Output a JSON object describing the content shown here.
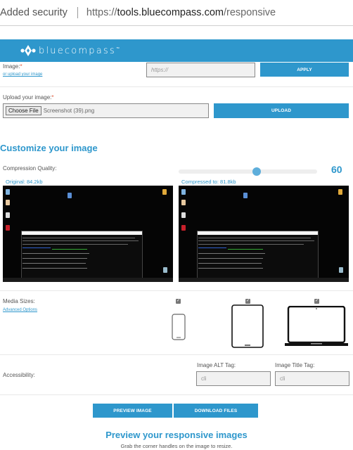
{
  "browser": {
    "security_label": "Added security",
    "url_prefix": "https://",
    "url_host": "tools.bluecompass.com",
    "url_path": "/responsive"
  },
  "brand": {
    "logo_text": "bluecompass",
    "trademark": "™",
    "bar_color": "#2e97cc"
  },
  "image_url_row": {
    "label": "Image:",
    "required_mark": "*",
    "upload_link": "or upload your image",
    "url_placeholder": "https://",
    "apply_label": "APPLY"
  },
  "upload_row": {
    "label": "Upload your image:",
    "required_mark": "*",
    "choose_file_label": "Choose File",
    "file_name": "Screenshot (39).png",
    "upload_label": "UPLOAD"
  },
  "customize": {
    "title": "Customize your image",
    "compression_label": "Compression Quality:",
    "compression_value": "60",
    "compression_fraction": 0.6,
    "original_label": "Original: 84.2kb",
    "compressed_label": "Compressed to: 81.8kb"
  },
  "media_sizes": {
    "label": "Media Sizes:",
    "advanced_link": "Advanced Options",
    "devices": [
      {
        "name": "phone",
        "checked": true,
        "check_glyph": "✓"
      },
      {
        "name": "tablet",
        "checked": true,
        "check_glyph": "✓"
      },
      {
        "name": "laptop",
        "checked": true,
        "check_glyph": "✓"
      }
    ]
  },
  "accessibility": {
    "label": "Accessibility:",
    "alt_label": "Image ALT Tag:",
    "alt_value": "cli",
    "title_label": "Image Title Tag:",
    "title_value": "cli"
  },
  "actions": {
    "preview_label": "PREVIEW IMAGE",
    "download_label": "DOWNLOAD FILES"
  },
  "preview": {
    "title": "Preview your responsive images",
    "subtitle": "Grab the corner handles on the image to resize."
  }
}
